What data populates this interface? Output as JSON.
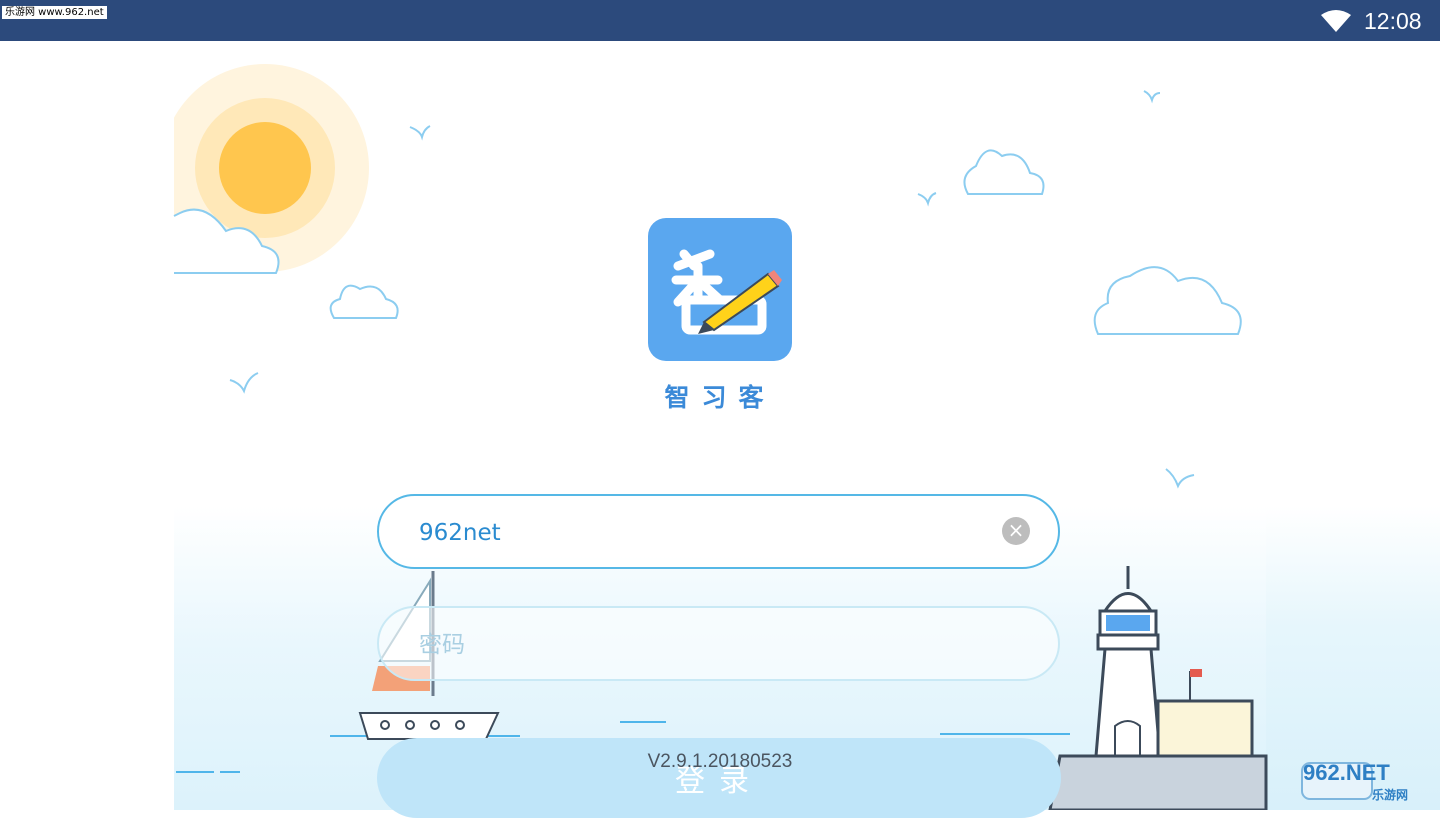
{
  "status_bar": {
    "source_watermark": "乐游网 www.962.net",
    "clock": "12:08",
    "wifi_icon": "wifi-icon",
    "background_color": "#2c4a7c"
  },
  "app": {
    "name": "智习客",
    "logo_icon": "zhi-pencil-logo-icon",
    "logo_color": "#5aa7ef"
  },
  "login": {
    "username_value": "962net",
    "password_placeholder": "密码",
    "clear_icon": "clear-icon",
    "login_label": "登录",
    "version": "V2.9.1.20180523",
    "accent_color": "#55b8e6"
  },
  "footer_watermark": {
    "text": "962.NET",
    "subtext": "乐游网"
  }
}
